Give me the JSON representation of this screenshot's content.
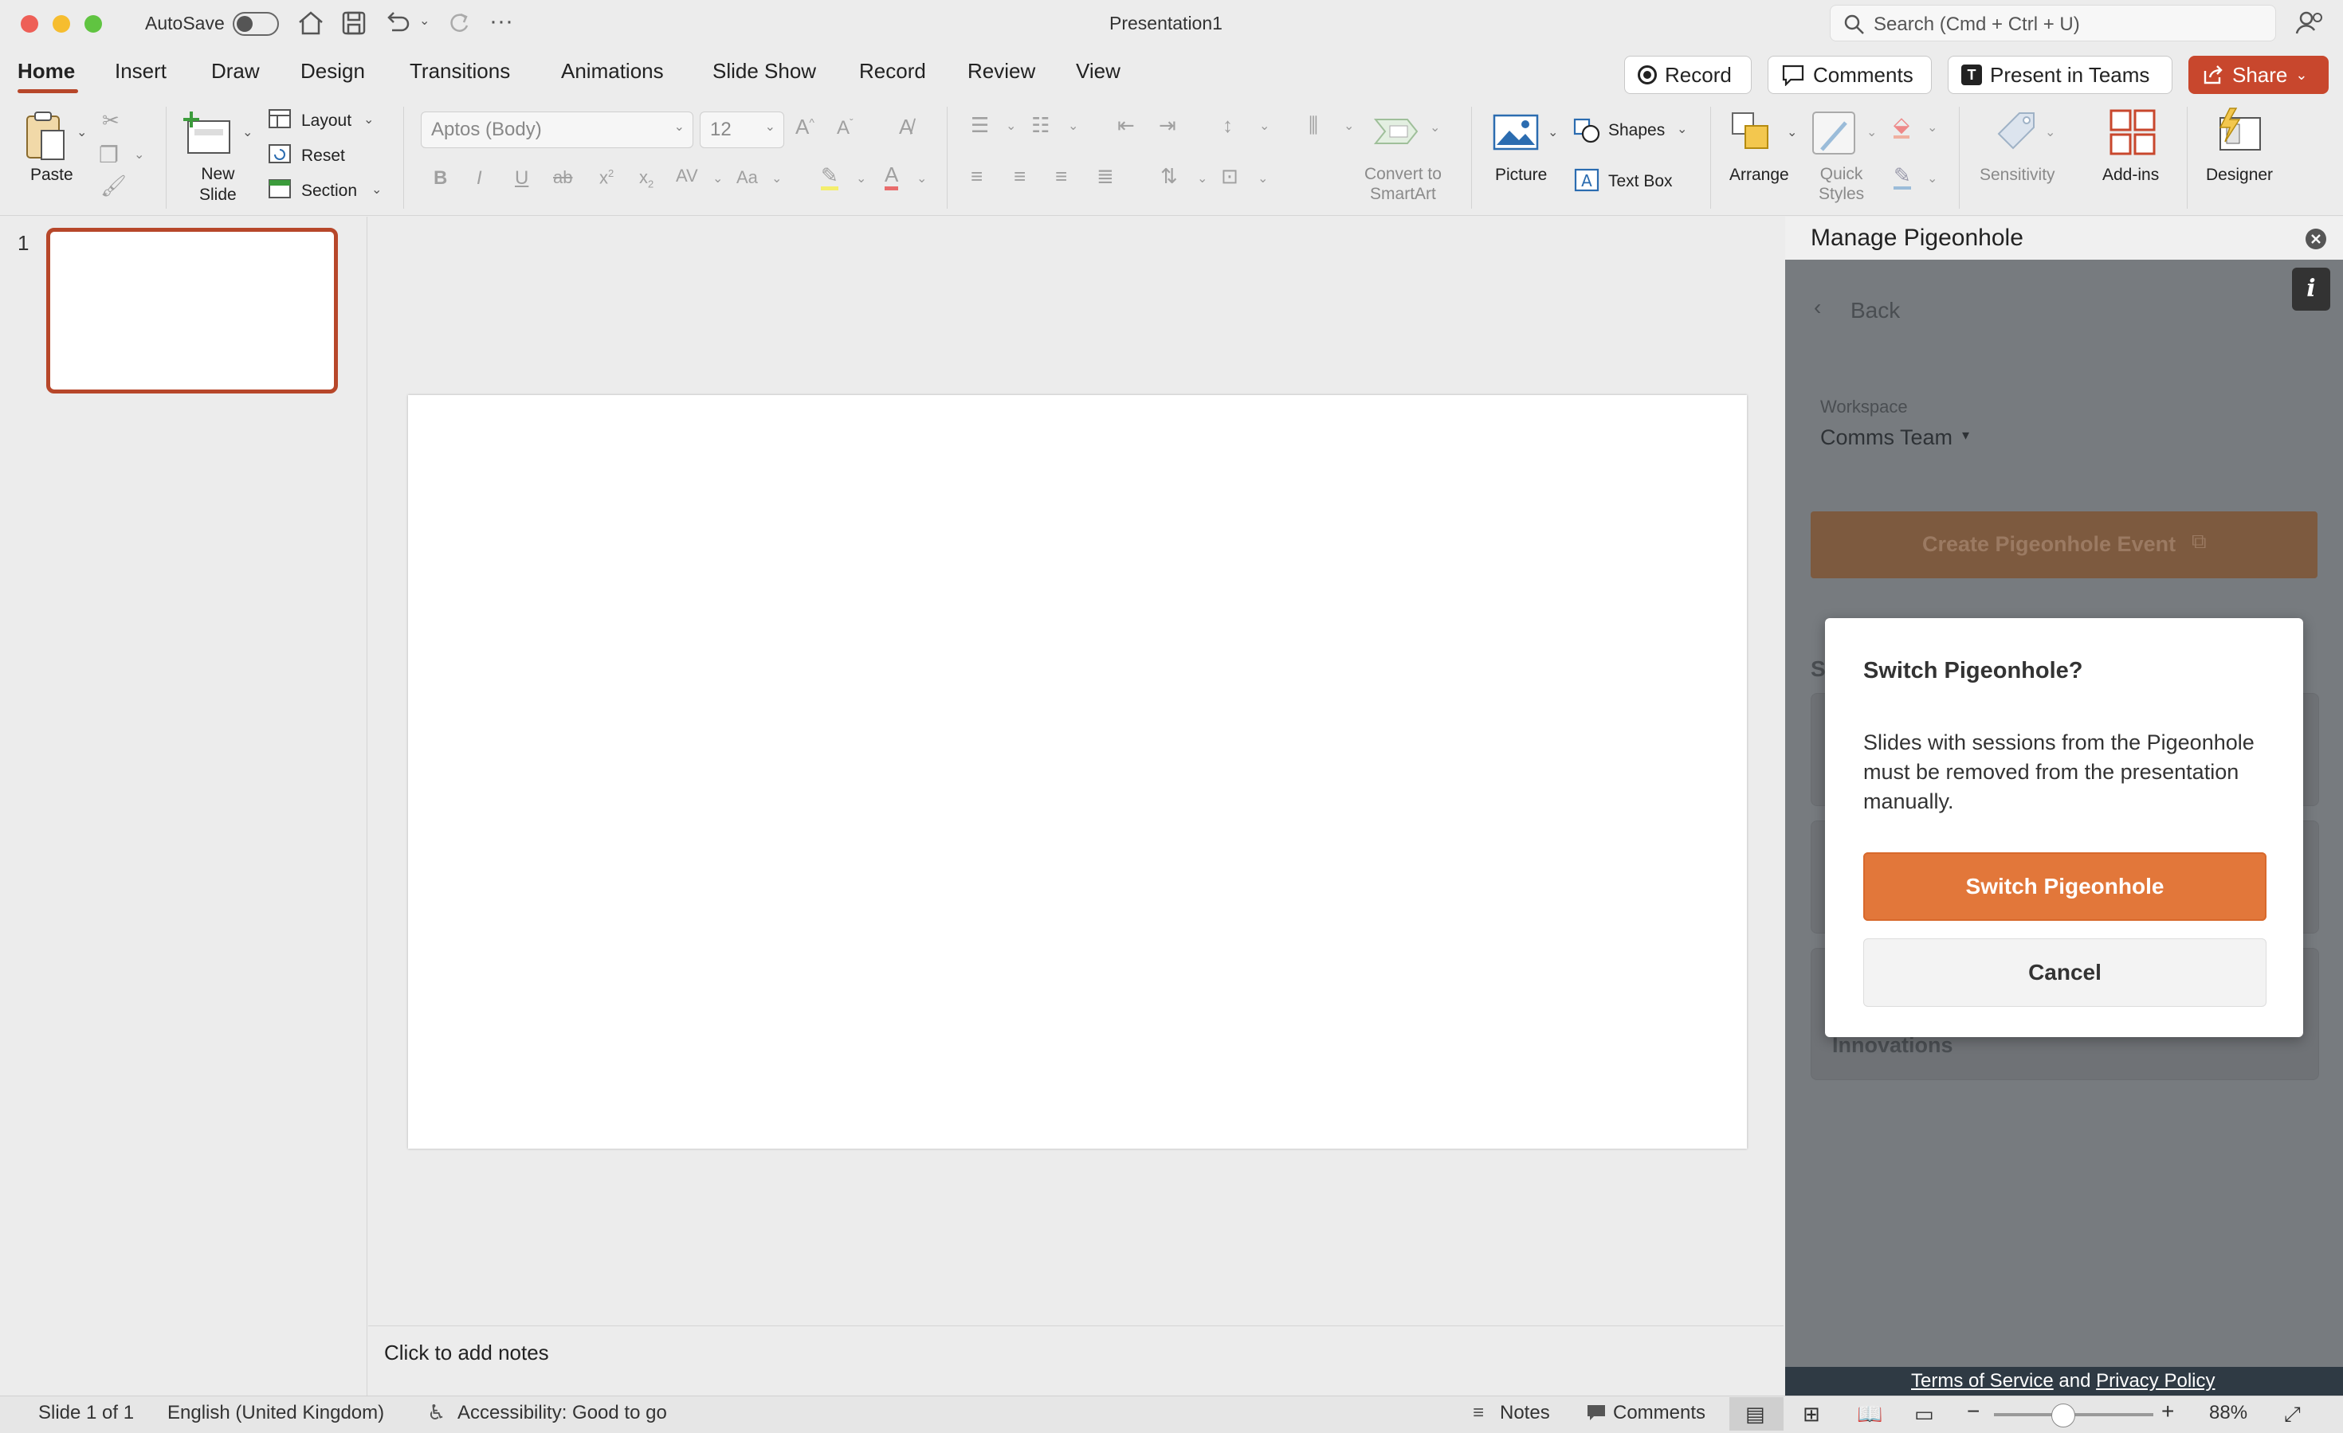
{
  "titlebar": {
    "autosave_label": "AutoSave",
    "document_title": "Presentation1",
    "search_placeholder": "Search (Cmd + Ctrl + U)"
  },
  "tabs": [
    "Home",
    "Insert",
    "Draw",
    "Design",
    "Transitions",
    "Animations",
    "Slide Show",
    "Record",
    "Review",
    "View"
  ],
  "actions": {
    "record": "Record",
    "comments": "Comments",
    "present_teams": "Present in Teams",
    "share": "Share"
  },
  "ribbon": {
    "paste": "Paste",
    "new_slide": [
      "New",
      "Slide"
    ],
    "layout": "Layout",
    "reset": "Reset",
    "section": "Section",
    "font_name": "Aptos (Body)",
    "font_size": "12",
    "convert_smartart": [
      "Convert to",
      "SmartArt"
    ],
    "picture": "Picture",
    "shapes": "Shapes",
    "text_box": "Text Box",
    "arrange": "Arrange",
    "quick_styles": [
      "Quick",
      "Styles"
    ],
    "sensitivity": "Sensitivity",
    "add_ins": "Add-ins",
    "designer": "Designer"
  },
  "thumbnails": {
    "slide_number": "1"
  },
  "notes": {
    "placeholder": "Click to add notes"
  },
  "pane": {
    "title": "Manage Pigeonhole",
    "back": "Back",
    "workspace_label": "Workspace",
    "workspace_value": "Comms Team",
    "create_button": "Create Pigeonhole Event",
    "peek_letter": "S",
    "peek_text": "Innovations",
    "footer_terms": "Terms of Service",
    "footer_and": " and ",
    "footer_privacy": "Privacy Policy"
  },
  "modal": {
    "title": "Switch Pigeonhole?",
    "body": "Slides with sessions from the Pigeonhole must be removed from the presentation manually.",
    "primary": "Switch Pigeonhole",
    "secondary": "Cancel"
  },
  "status": {
    "slide": "Slide 1 of 1",
    "language": "English (United Kingdom)",
    "accessibility": "Accessibility: Good to go",
    "notes": "Notes",
    "comments": "Comments",
    "zoom": "88%"
  },
  "colors": {
    "accent": "#b7472a",
    "share": "#c8472d",
    "primary_button": "#e2773a"
  }
}
